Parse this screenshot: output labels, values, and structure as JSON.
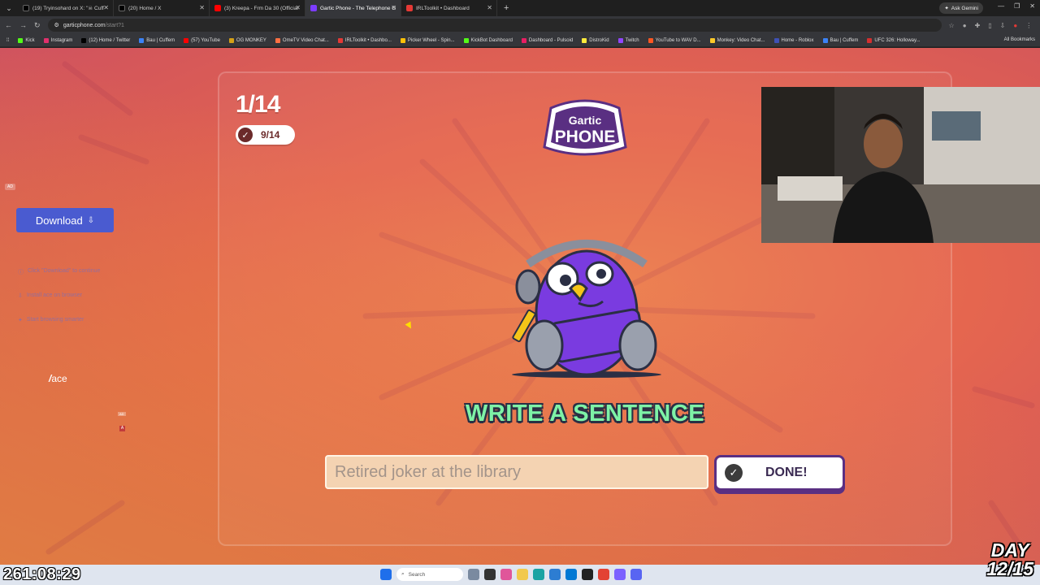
{
  "browser": {
    "tabs": [
      {
        "label": "(19) Tryinsohard on X: \"☠ Cuff",
        "color": "#000000",
        "icon": "x-icon"
      },
      {
        "label": "(20) Home / X",
        "color": "#000000",
        "icon": "x-icon"
      },
      {
        "label": "(3) Kreepa - Frm Da 30 (Official",
        "color": "#ff0000",
        "icon": "youtube-icon"
      },
      {
        "label": "Gartic Phone - The Telephone G",
        "color": "#7d3cff",
        "icon": "gartic-icon",
        "active": true
      },
      {
        "label": "IRLToolkit • Dashboard",
        "color": "#e53935",
        "icon": "irltoolkit-icon"
      }
    ],
    "ask_gemini": "Ask Gemini",
    "url": "garticphone.com",
    "url_path": "/start?1",
    "bookmarks": [
      {
        "label": "Kick",
        "color": "#53fc18"
      },
      {
        "label": "Instagram",
        "color": "#e1306c"
      },
      {
        "label": "(12) Home / Twitter",
        "color": "#000000"
      },
      {
        "label": "Bau | Cuffem",
        "color": "#3b82f6"
      },
      {
        "label": "(57) YouTube",
        "color": "#ff0000"
      },
      {
        "label": "OG MONKEY",
        "color": "#d4a017"
      },
      {
        "label": "OmeTV Video Chat...",
        "color": "#ff7043"
      },
      {
        "label": "IRLToolkit • Dashbo...",
        "color": "#e53935"
      },
      {
        "label": "Picker Wheel - Spin...",
        "color": "#ffc107"
      },
      {
        "label": "KickBot Dashboard",
        "color": "#53fc18"
      },
      {
        "label": "Dashboard - Pulsoid",
        "color": "#e91e63"
      },
      {
        "label": "DistroKid",
        "color": "#ffeb3b"
      },
      {
        "label": "Twitch",
        "color": "#9146ff"
      },
      {
        "label": "YouTube to WAV D...",
        "color": "#ff5722"
      },
      {
        "label": "Monkey: Video Chat...",
        "color": "#ffca28"
      },
      {
        "label": "Home - Roblox",
        "color": "#3f51b5"
      },
      {
        "label": "Bau | Cuffem",
        "color": "#3b82f6"
      },
      {
        "label": "UFC 326: Holloway...",
        "color": "#d32f2f"
      }
    ],
    "all_bookmarks": "All Bookmarks"
  },
  "ad": {
    "tag": "AD",
    "download_label": "Download",
    "lines": [
      "Click \"Download\" to continue",
      "Install ace on browser",
      "Start browsing smarter"
    ],
    "brand": "ace",
    "mini_tag": "AD",
    "badge": "A"
  },
  "game": {
    "round": "1/14",
    "progress": "9/14",
    "logo_top": "Gartic",
    "logo_bottom": "PHONE",
    "instruction": "WRITE A SENTENCE",
    "input_value": "Retired joker at the library",
    "done_label": "DONE!"
  },
  "taskbar": {
    "search_label": "Search"
  },
  "overlay": {
    "timer": "261:08:29",
    "day_line1": "DAY",
    "day_line2": "12/15"
  }
}
